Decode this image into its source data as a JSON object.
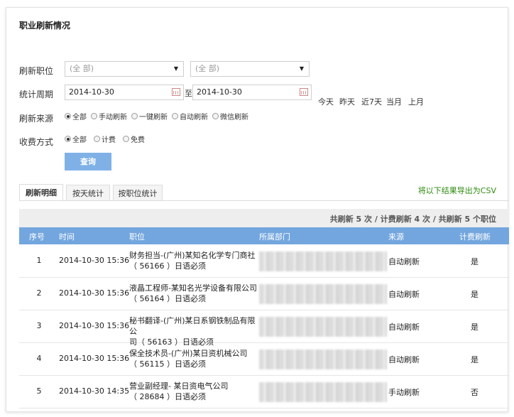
{
  "page": {
    "title": "职业刷新情况"
  },
  "filters": {
    "position": {
      "label": "刷新职位",
      "select1": "(全 部)",
      "select2": "(全 部)"
    },
    "period": {
      "label": "统计周期",
      "start": "2014-10-30",
      "to": "至",
      "end": "2014-10-30",
      "quick": [
        "今天",
        "昨天",
        "近7天",
        "当月",
        "上月"
      ]
    },
    "source": {
      "label": "刷新来源",
      "options": [
        "全部",
        "手动刷新",
        "一键刷新",
        "自动刷新",
        "微信刷新"
      ],
      "selected_index": 0
    },
    "fee": {
      "label": "收费方式",
      "options": [
        "全部",
        "计费",
        "免费"
      ],
      "selected_index": 0
    },
    "query_button": "查询"
  },
  "tabs": [
    "刷新明细",
    "按天统计",
    "按职位统计"
  ],
  "active_tab_index": 0,
  "export_link": "将以下结果导出为CSV",
  "summary": "共刷新 5 次 / 计费刷新 4 次 / 共刷新 5 个职位",
  "table": {
    "headers": [
      "序号",
      "时间",
      "职位",
      "所属部门",
      "来源",
      "计费刷新"
    ],
    "rows": [
      {
        "seq": "1",
        "time": "2014-10-30 15:36",
        "pos1": "财务担当-(广州)某知名化学专门商社",
        "pos2": "（ 56166 ）日语必须",
        "source": "自动刷新",
        "fee": "是"
      },
      {
        "seq": "2",
        "time": "2014-10-30 15:36",
        "pos1": "液晶工程师-某知名光学设备有限公司",
        "pos2": "（ 56164 ）日语必须",
        "source": "自动刷新",
        "fee": "是"
      },
      {
        "seq": "3",
        "time": "2014-10-30 15:36",
        "pos1": "秘书翻译-(广州)某日系钢铁制品有限公",
        "pos2": "司（ 56163 ）日语必须",
        "source": "自动刷新",
        "fee": "是"
      },
      {
        "seq": "4",
        "time": "2014-10-30 15:36",
        "pos1": "保全技术员-(广州)某日资机械公司",
        "pos2": "（ 56115 ）日语必须",
        "source": "自动刷新",
        "fee": "是"
      },
      {
        "seq": "5",
        "time": "2014-10-30 14:35",
        "pos1": "营业副经理- 某日资电气公司",
        "pos2": "（ 28684 ）日语必须",
        "source": "手动刷新",
        "fee": "否"
      }
    ]
  }
}
